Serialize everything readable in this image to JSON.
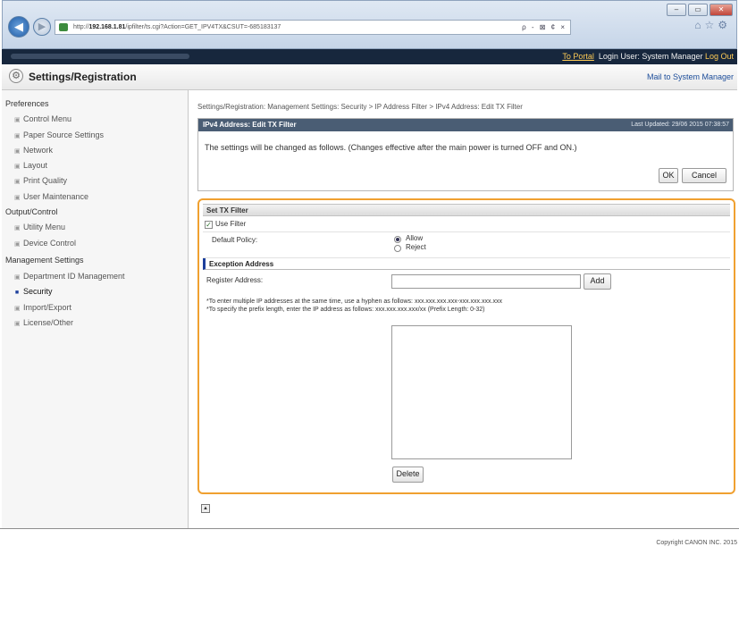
{
  "browser": {
    "url_prefix": "http://",
    "url_host": "192.168.1.81",
    "url_path": "/ipfilter/ts.cgi?Action=GET_IPV4TX&CSUT=-685183137",
    "address_tools": "ρ - ⊠ ¢ ×",
    "icons": [
      "home-icon",
      "favorites-icon",
      "settings-icon"
    ],
    "window_buttons": [
      "minimize",
      "restore",
      "close"
    ]
  },
  "topbar": {
    "portal_link": "To Portal",
    "login_label": "Login User:",
    "login_user": "System Manager",
    "logout_link": "Log Out"
  },
  "header": {
    "title": "Settings/Registration",
    "mail_link": "Mail to System Manager"
  },
  "sidebar": {
    "groups": [
      {
        "label": "Preferences",
        "items": [
          {
            "label": "Control Menu"
          },
          {
            "label": "Paper Source Settings"
          },
          {
            "label": "Network"
          },
          {
            "label": "Layout"
          },
          {
            "label": "Print Quality"
          },
          {
            "label": "User Maintenance"
          }
        ]
      },
      {
        "label": "Output/Control",
        "items": [
          {
            "label": "Utility Menu"
          },
          {
            "label": "Device Control"
          }
        ]
      },
      {
        "label": "Management Settings",
        "items": [
          {
            "label": "Department ID Management"
          },
          {
            "label": "Security"
          },
          {
            "label": "Import/Export"
          },
          {
            "label": "License/Other"
          }
        ]
      }
    ]
  },
  "breadcrumb": "Settings/Registration: Management Settings: Security > IP Address Filter > IPv4 Address: Edit TX Filter",
  "panel": {
    "title": "IPv4 Address: Edit TX Filter",
    "last_updated": "Last Updated: 29/06 2015 07:38:57",
    "message": "The settings will be changed as follows. (Changes effective after the main power is turned OFF and ON.)",
    "ok_label": "OK",
    "cancel_label": "Cancel"
  },
  "filter": {
    "section_title": "Set TX Filter",
    "use_filter_label": "Use Filter",
    "use_filter_checked": true,
    "default_policy_label": "Default Policy:",
    "policy_options": [
      "Allow",
      "Reject"
    ],
    "policy_selected": "Allow",
    "exception_title": "Exception Address",
    "register_label": "Register Address:",
    "register_value": "",
    "add_label": "Add",
    "hint1": "*To enter multiple IP addresses at the same time, use a hyphen as follows: xxx.xxx.xxx.xxx-xxx.xxx.xxx.xxx",
    "hint2": "*To specify the prefix length, enter the IP address as follows: xxx.xxx.xxx.xxx/xx (Prefix Length: 0-32)",
    "delete_label": "Delete"
  },
  "footer": {
    "copyright": "Copyright CANON INC. 2015",
    "top_icon_glyph": "▲"
  },
  "colors": {
    "highlight_border": "#f0a030",
    "panel_header": "#4a5d74",
    "top_bar": "#17273d"
  }
}
